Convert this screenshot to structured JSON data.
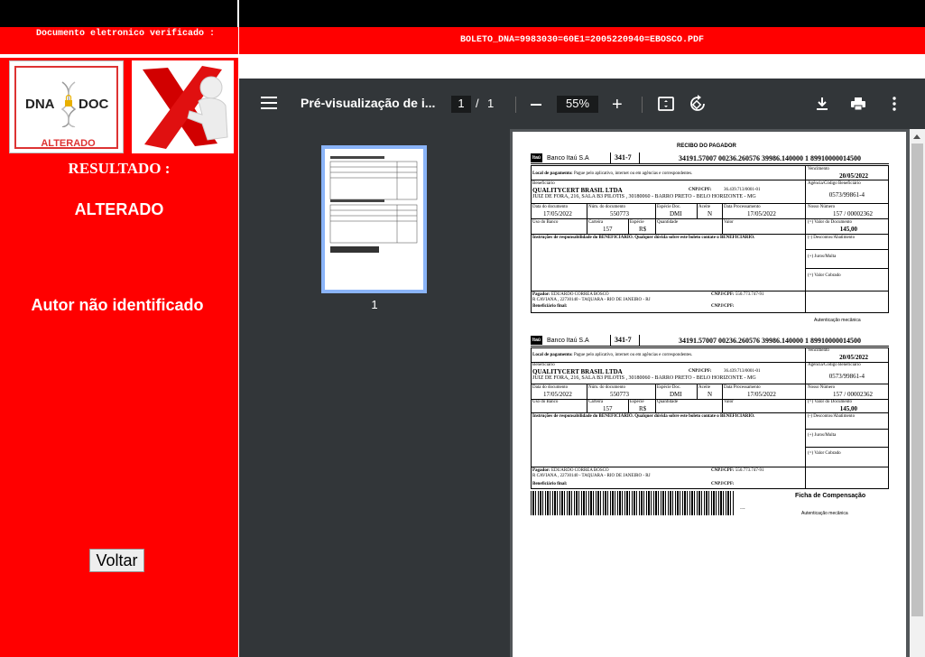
{
  "top": {
    "verified_label": "Documento eletronico verificado :",
    "filename": "BOLETO_DNA=9983030=60E1=2005220940=EBOSCO.PDF"
  },
  "left": {
    "logo_dna": "DNA",
    "logo_doc": "DOC",
    "logo_status": "ALTERADO",
    "result_title": "RESULTADO :",
    "result_value": "ALTERADO",
    "author": "Autor não identificado",
    "back_button": "Voltar"
  },
  "viewer": {
    "title": "Pré-visualização de i...",
    "page_current": "1",
    "page_separator": "/",
    "page_total": "1",
    "zoom": "55%",
    "thumb_label": "1",
    "icons": [
      "menu-icon",
      "fit-page-icon",
      "rotate-icon",
      "download-icon",
      "print-icon",
      "more-icon"
    ]
  },
  "doc": {
    "recibo_title": "RECIBO DO PAGADOR",
    "bank_name": "Banco Itaú S.A",
    "bank_logo": "Itaú",
    "bank_code": "341-7",
    "digitable_line": "34191.57007 00236.260576 39986.140000 1 89910000014500",
    "local_label": "Local de pagamento:",
    "local_value": "Pague pelo aplicativo, internet ou em agências e correspondentes.",
    "vencimento_label": "Vencimento",
    "vencimento": "20/05/2022",
    "beneficiario_label": "Beneficiário",
    "beneficiario": "QUALITYCERT BRASIL LTDA",
    "cnpj_label": "CNPJ/CPF:",
    "cnpj": "36.439.713/0001-01",
    "endereco": "JUIZ DE FORA, 216, SALA B3 PILOTIS , 30180060 - BARRO PRETO - BELO HORIZONTE - MG",
    "agencia_label": "Agência/Código Beneficiário",
    "agencia": "0573/99861-4",
    "data_doc_label": "Data do documento",
    "data_doc": "17/05/2022",
    "num_doc_label": "Núm. do documento",
    "num_doc": "550773",
    "especie_doc_label": "Espécie Doc.",
    "especie_doc": "DMI",
    "aceite_label": "Aceite",
    "aceite": "N",
    "data_proc_label": "Data Processamento",
    "data_proc": "17/05/2022",
    "nosso_label": "Nosso Número",
    "nosso": "157 / 00002362",
    "uso_banco_label": "Uso do Banco",
    "carteira_label": "Carteira",
    "carteira": "157",
    "especie_label": "Espécie",
    "especie": "R$",
    "quantidade_label": "Quantidade",
    "valor_label": "Valor",
    "valor_doc_label": "(=) Valor do Documento",
    "valor_doc": "145,00",
    "instrucoes": "Instruções de responsabilidade do BENEFICIÁRIO. Qualquer dúvida sobre este boleto contate o BENEFICIÁRIO.",
    "descontos": "(-) Descontos/Abatimento",
    "juros": "(+) Juros/Multa",
    "cobrado": "(=) Valor Cobrado",
    "pagador_label": "Pagador:",
    "pagador": "EDUARDO CORREA BOSCO",
    "pagador_cnpj_label": "CNPJ/CPF:",
    "pagador_cnpj": "550.773.747-91",
    "pagador_end": "R CAVIANA , 22730140 - TAQUARA - RIO DE JANEIRO - RJ",
    "benef_final_label": "Beneficiário final:",
    "benef_final_cnpj": "CNPJ/CPF:",
    "autenticacao": "Autenticação mecânica",
    "ficha": "Ficha de Compensação",
    "barcode_dots": "..."
  }
}
